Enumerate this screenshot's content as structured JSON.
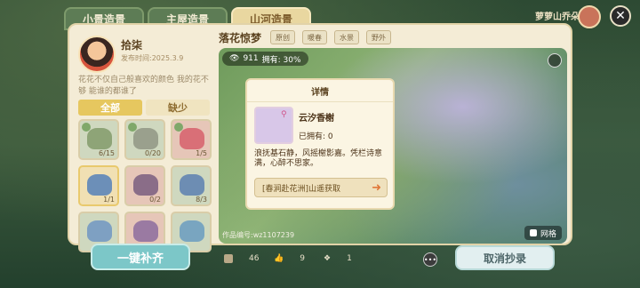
{
  "top_tabs": [
    {
      "label": "小景造景"
    },
    {
      "label": "主屋造景"
    },
    {
      "label": "山河造景"
    }
  ],
  "top_right_user": "萝萝山乔朵朵",
  "author": {
    "name": "拾柒",
    "publish_time": "发布时间:2025.3.9",
    "description": "花花不仅自己般喜欢的颜色 我的花不够 能谁的都谁了"
  },
  "filters": {
    "all": "全部",
    "missing": "缺少"
  },
  "items": [
    {
      "count": "6/15",
      "style": "green"
    },
    {
      "count": "0/20",
      "style": "green"
    },
    {
      "count": "1/5",
      "style": "pink"
    },
    {
      "count": "1/1",
      "style": "yellow"
    },
    {
      "count": "0/2",
      "style": "pink"
    },
    {
      "count": "8/3",
      "style": "green"
    },
    {
      "count": "",
      "style": "green"
    },
    {
      "count": "",
      "style": "pink"
    },
    {
      "count": "",
      "style": "green"
    }
  ],
  "work": {
    "title": "落花惊梦",
    "tags": [
      "原创",
      "暖春",
      "水景",
      "野外"
    ],
    "views": "911",
    "owned_rate": "拥有: 30%",
    "work_id": "作品编号:wz1107239",
    "grid_label": "网格"
  },
  "popup": {
    "title": "详情",
    "item_name": "云汐香榭",
    "owned": "已拥有: 0",
    "description": "浪抚基石静，风摇榭影嘉。凭栏诗意满，心醉不思家。",
    "source": "[春涧赴花洲]山遥获取"
  },
  "bottom": {
    "fill_all": "一键补齐",
    "cancel_copy": "取消抄录",
    "stats": [
      "46",
      "9",
      "1"
    ]
  }
}
